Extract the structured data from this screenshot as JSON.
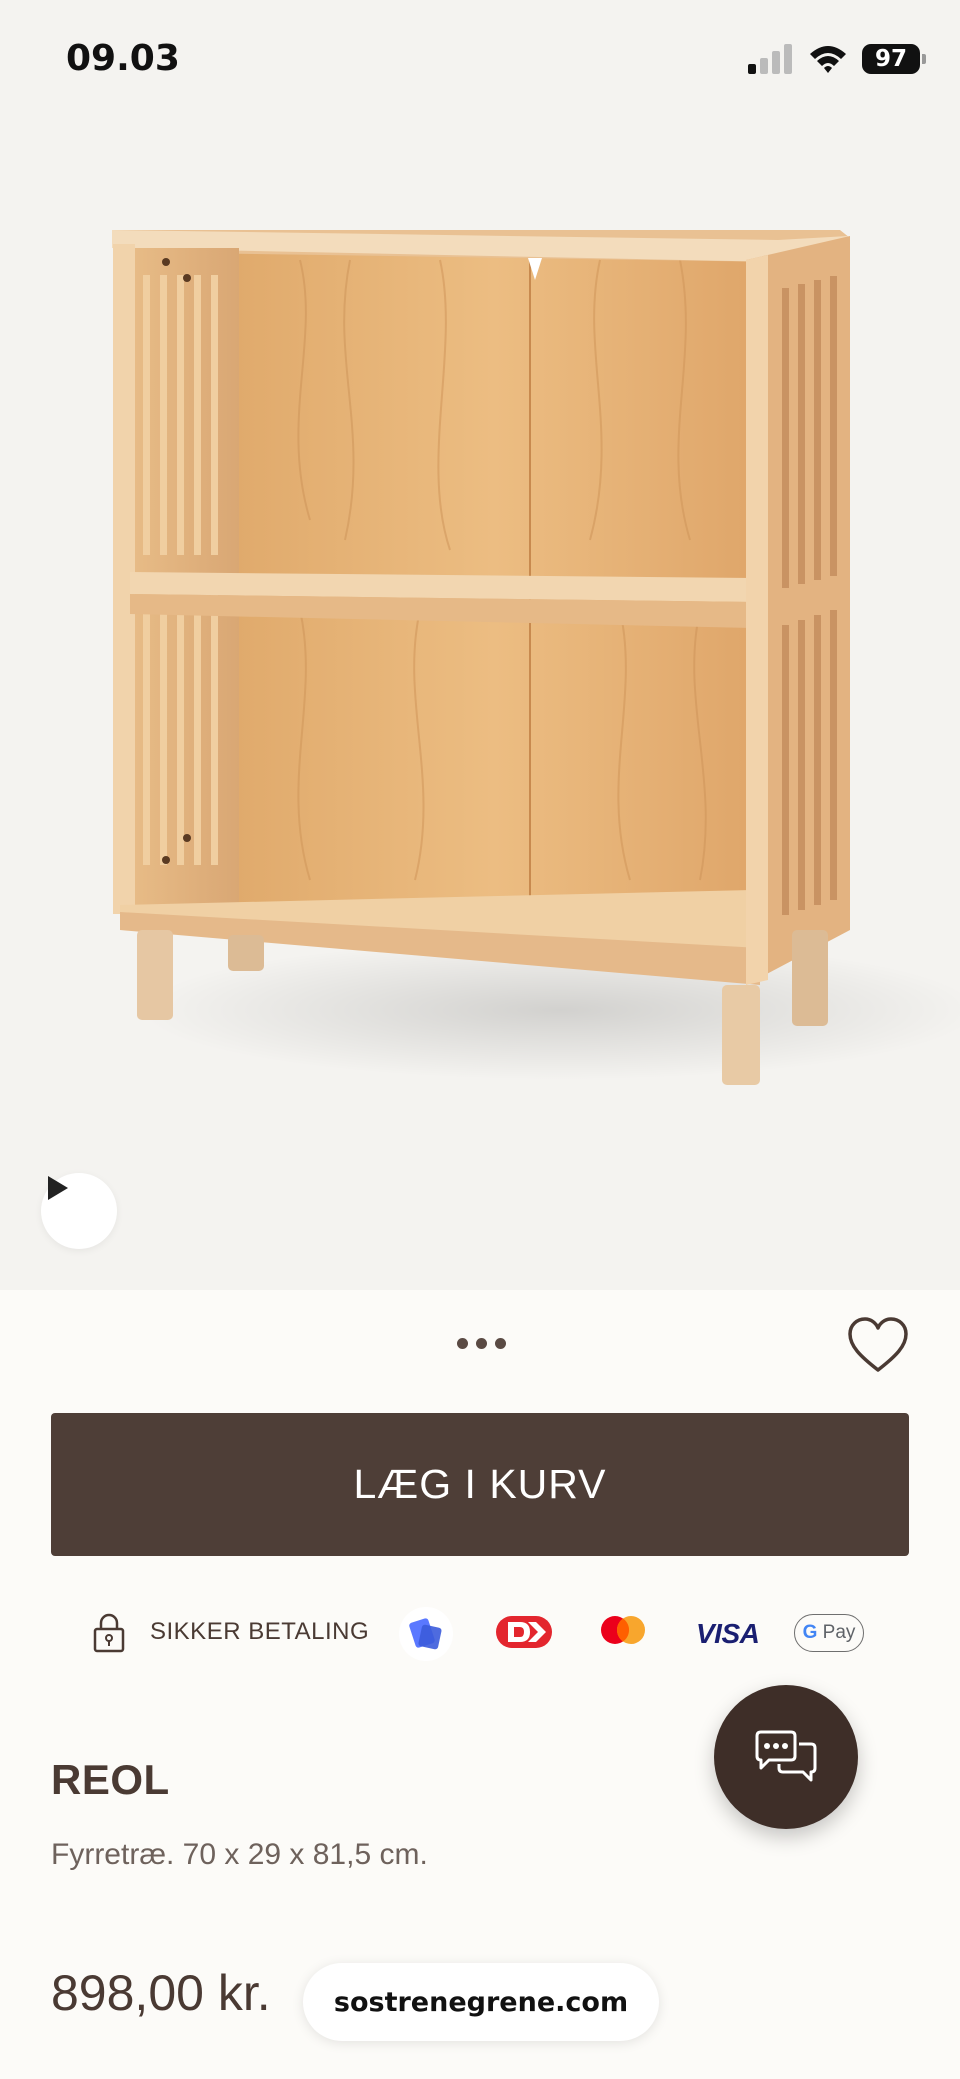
{
  "status_bar": {
    "time": "09.03",
    "battery": "97",
    "signal_icon": "cellular-signal-icon",
    "wifi_icon": "wifi-icon"
  },
  "gallery": {
    "image": "wooden-bookshelf-product-photo",
    "play_icon": "play-icon",
    "dots_icon": "more-dots-icon",
    "wishlist_icon": "heart-icon"
  },
  "cart": {
    "add_label": "LÆG I KURV"
  },
  "payment": {
    "secure_label": "SIKKER BETALING",
    "visa_label": "VISA",
    "gpay_g": "G",
    "gpay_pay": "Pay"
  },
  "product": {
    "name": "REOL",
    "description": "Fyrretræ. 70 x 29 x 81,5 cm.",
    "price": "898,00 kr."
  },
  "browser": {
    "url": "sostrenegrene.com"
  },
  "colors": {
    "brand_brown": "#4e3e37",
    "chat_brown": "#3e2e28",
    "background": "#fcfbf8",
    "hero_background": "#f4f3f0"
  }
}
